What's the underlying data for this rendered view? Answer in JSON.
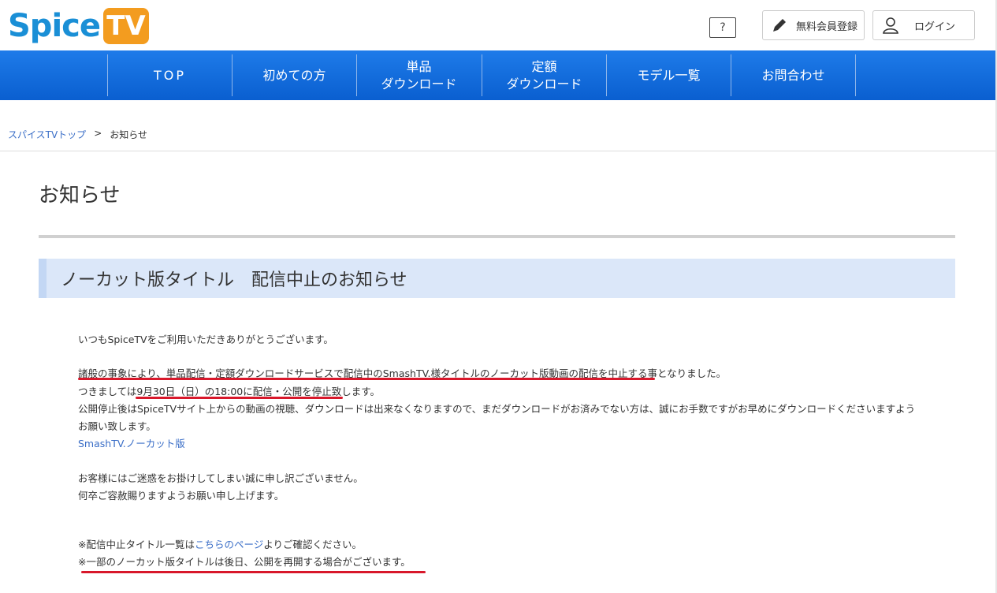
{
  "header": {
    "logo_text": "Spice",
    "logo_tv": "TV",
    "help_icon": "question-bubble-icon",
    "register_label": "無料会員登録",
    "login_label": "ログイン"
  },
  "nav": {
    "items": [
      {
        "label": "TOP"
      },
      {
        "label": "初めての方"
      },
      {
        "label_line1": "単品",
        "label_line2": "ダウンロード"
      },
      {
        "label_line1": "定額",
        "label_line2": "ダウンロード"
      },
      {
        "label": "モデル一覧"
      },
      {
        "label": "お問合わせ"
      }
    ]
  },
  "breadcrumb": {
    "home": "スパイスTVトップ",
    "separator": ">",
    "current": "お知らせ"
  },
  "page": {
    "title": "お知らせ",
    "notice_title": "ノーカット版タイトル　配信中止のお知らせ",
    "paragraphs": {
      "p1": "いつもSpiceTVをご利用いただきありがとうございます。",
      "p2": "諸般の事象により、単品配信・定額ダウンロードサービスで配信中のSmashTV.様タイトルのノーカット版動画の配信を中止する事となりました。",
      "p3": "つきましては9月30日（日）の18:00に配信・公開を停止致します。",
      "p4": "公開停止後はSpiceTVサイト上からの動画の視聴、ダウンロードは出来なくなりますので、まだダウンロードがお済みでない方は、誠にお手数ですがお早めにダウンロードくださいますよう",
      "p5": "お願い致します。",
      "link1": "SmashTV.ノーカット版",
      "p6": "お客様にはご迷惑をお掛けしてしまい誠に申し訳ございません。",
      "p7": "何卒ご容赦賜りますようお願い申し上げます。",
      "p8_prefix": "※配信中止タイトル一覧は",
      "p8_link": "こちらのページ",
      "p8_suffix": "よりご確認ください。",
      "p9": "※一部のノーカット版タイトルは後日、公開を再開する場合がございます。"
    }
  },
  "colors": {
    "nav_blue": "#1e7be9",
    "link_blue": "#3a6ec7",
    "underline_red": "#d8182b",
    "notice_bg": "#dbe7f9"
  }
}
